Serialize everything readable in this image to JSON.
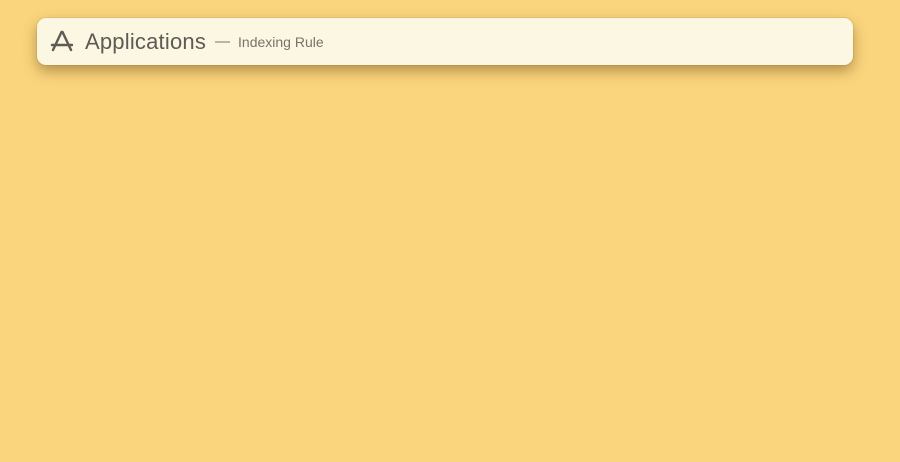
{
  "search": {
    "query": "Applications",
    "separator": "—",
    "subtitle": "Indexing Rule",
    "icon": "app-store-icon"
  },
  "colors": {
    "background": "#fbd57d",
    "bar": "#fbf7e2",
    "text": "#5e5a55"
  }
}
